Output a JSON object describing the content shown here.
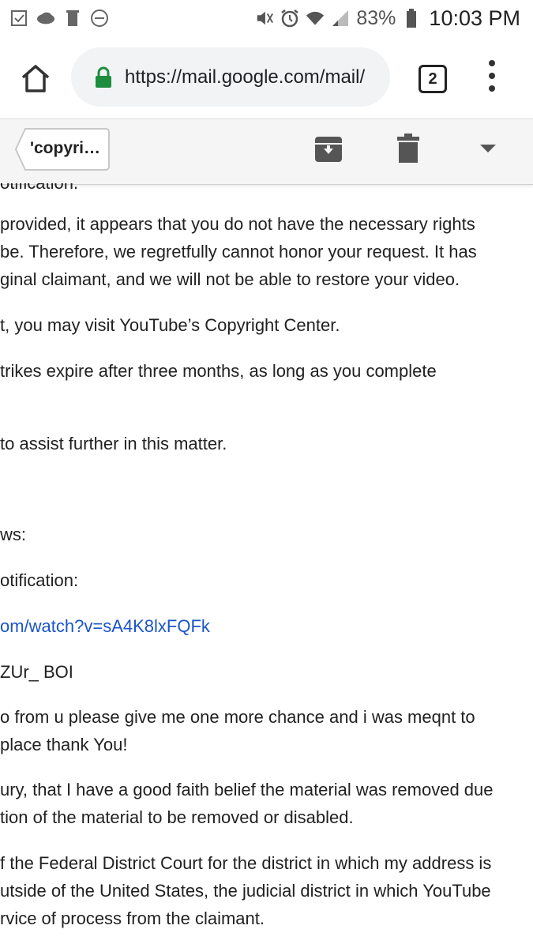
{
  "status_bar": {
    "battery_percent": "83%",
    "time": "10:03 PM",
    "left_icons": [
      "task-icon",
      "cloud-icon",
      "trash-notify-icon",
      "do-not-disturb-icon"
    ],
    "right_icons": [
      "mute-icon",
      "alarm-icon",
      "wifi-icon",
      "signal-icon",
      "battery-icon"
    ]
  },
  "browser": {
    "url": "https://mail.google.com/mail/",
    "tab_count": "2"
  },
  "gmail_toolbar": {
    "back_label": "'copyri…"
  },
  "email": {
    "cut_top": "otification.",
    "lines": [
      "provided, it appears that you do not have the necessary rights",
      "be. Therefore, we regretfully cannot honor your request. It has",
      "ginal claimant, and we will not be able to restore your video.",
      "t, you may visit YouTube’s Copyright Center.",
      "trikes expire after three months, as long as you complete",
      "to assist further in this matter.",
      "ws:",
      "otification:",
      "om/watch?v=sA4K8lxFQFk",
      "ZUr_ BOI",
      "o from u please give me one more chance and i was meqnt to",
      " place thank You!",
      "ury, that I have a good faith belief the material was removed due",
      "tion of the material to be removed or disabled.",
      "f the Federal District Court for the district in which my address is",
      "utside of the United States, the judicial district in which YouTube",
      "rvice of process from the claimant."
    ]
  },
  "colors": {
    "link": "#1a56c8",
    "lock": "#1e8e3e",
    "text": "#212121"
  }
}
